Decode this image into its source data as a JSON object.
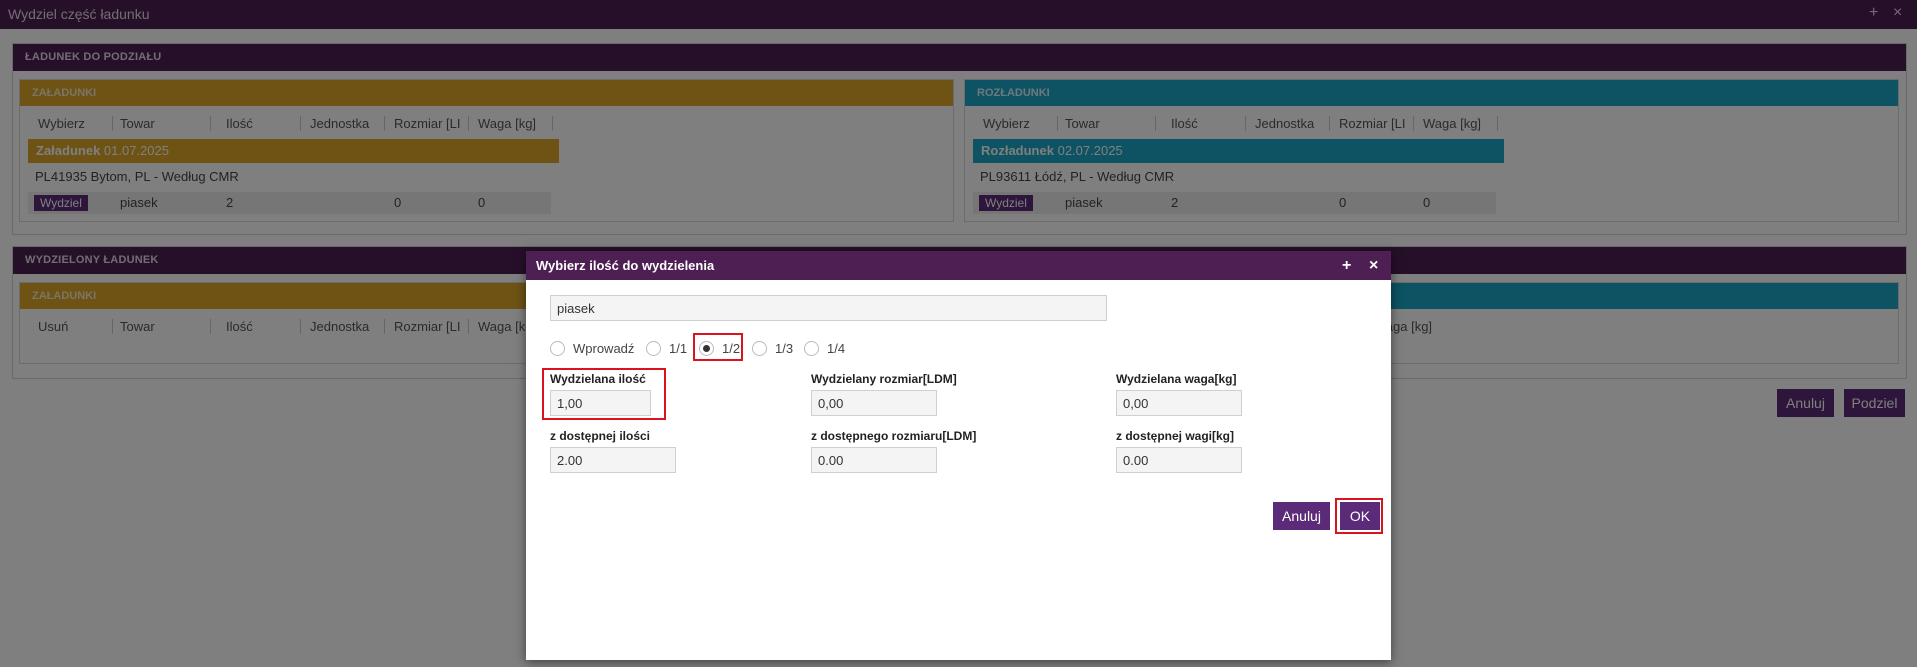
{
  "window": {
    "title": "Wydziel część ładunku",
    "add_icon": "+",
    "close_icon": "×"
  },
  "section1": {
    "title": "ŁADUNEK DO PODZIAŁU",
    "left": {
      "title": "ZAŁADUNKI",
      "columns": [
        "Wybierz",
        "Towar",
        "Ilość",
        "Jednostka",
        "Rozmiar [LI",
        "Waga [kg]"
      ],
      "group_label": "Załadunek",
      "group_date": "01.07.2025",
      "location": "PL41935 Bytom, PL - Według CMR",
      "item": {
        "button": "Wydziel",
        "towar": "piasek",
        "ilosc": "2",
        "rozmiar": "0",
        "waga": "0"
      }
    },
    "right": {
      "title": "ROZŁADUNKI",
      "columns": [
        "Wybierz",
        "Towar",
        "Ilość",
        "Jednostka",
        "Rozmiar [LI",
        "Waga [kg]"
      ],
      "group_label": "Rozładunek",
      "group_date": "02.07.2025",
      "location": "PL93611 Łódź, PL - Według CMR",
      "item": {
        "button": "Wydziel",
        "towar": "piasek",
        "ilosc": "2",
        "rozmiar": "0",
        "waga": "0"
      }
    }
  },
  "section2": {
    "title": "WYDZIELONY ŁADUNEK",
    "left": {
      "title": "ZAŁADUNKI",
      "columns": [
        "Usuń",
        "Towar",
        "Ilość",
        "Jednostka",
        "Rozmiar [LI",
        "Waga [kg]"
      ]
    },
    "right": {
      "columns_tail": "Waga [kg]"
    }
  },
  "footer_buttons": {
    "cancel": "Anuluj",
    "split": "Podziel"
  },
  "dialog": {
    "title": "Wybierz ilość do wydzielenia",
    "add_icon": "+",
    "close_icon": "×",
    "product": "piasek",
    "radio_options": [
      "Wprowadź",
      "1/1",
      "1/2",
      "1/3",
      "1/4"
    ],
    "selected_option": "1/2",
    "qty_label": "Wydzielana ilość",
    "qty_value": "1,00",
    "size_label": "Wydzielany rozmiar[LDM]",
    "size_value": "0,00",
    "weight_label": "Wydzielana waga[kg]",
    "weight_value": "0,00",
    "avail_qty_label": "z dostępnej ilości",
    "avail_qty_value": "2.00",
    "avail_size_label": "z dostępnego rozmiaru[LDM]",
    "avail_size_value": "0.00",
    "avail_weight_label": "z dostępnej wagi[kg]",
    "avail_weight_value": "0.00",
    "cancel_button": "Anuluj",
    "ok_button": "OK"
  },
  "colors": {
    "purple": "#4d1f52",
    "button_purple": "#5b2a78",
    "gold": "#dca62a",
    "teal": "#1ba6c6",
    "highlight": "#d9141c"
  }
}
